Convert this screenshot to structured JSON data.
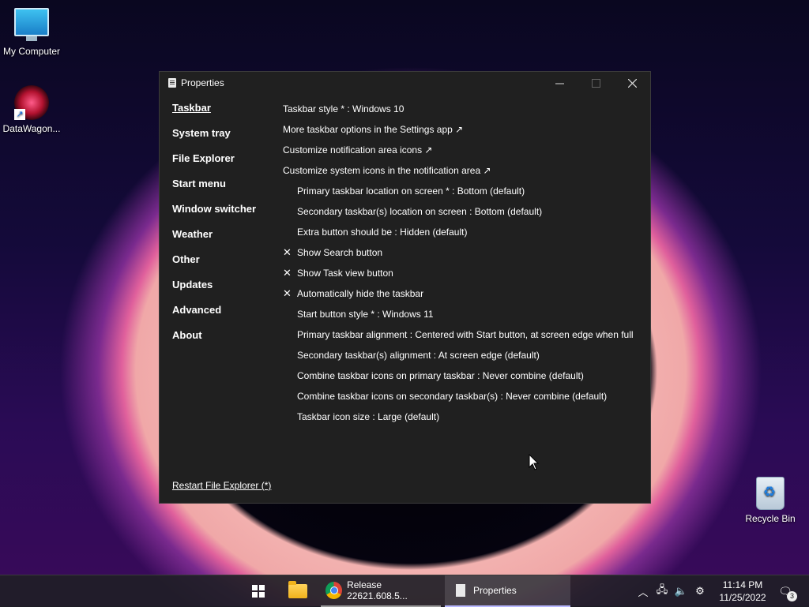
{
  "desktop": {
    "icons": [
      {
        "label": "My Computer"
      },
      {
        "label": "DataWagon..."
      },
      {
        "label": "Recycle Bin"
      }
    ]
  },
  "window": {
    "title": "Properties",
    "sidebar": [
      {
        "label": "Taskbar",
        "active": true
      },
      {
        "label": "System tray"
      },
      {
        "label": "File Explorer"
      },
      {
        "label": "Start menu"
      },
      {
        "label": "Window switcher"
      },
      {
        "label": "Weather"
      },
      {
        "label": "Other"
      },
      {
        "label": "Updates"
      },
      {
        "label": "Advanced"
      },
      {
        "label": "About"
      }
    ],
    "restart_link": "Restart File Explorer (*)",
    "settings": [
      {
        "text": "Taskbar style * : Windows 10"
      },
      {
        "text": "More taskbar options in the Settings app ↗"
      },
      {
        "text": "Customize notification area icons ↗"
      },
      {
        "text": "Customize system icons in the notification area ↗"
      },
      {
        "text": "Primary taskbar location on screen * : Bottom (default)"
      },
      {
        "text": "Secondary taskbar(s) location on screen : Bottom (default)"
      },
      {
        "text": "Extra button should be : Hidden (default)"
      },
      {
        "text": "Show Search button",
        "mark": "✕"
      },
      {
        "text": "Show Task view button",
        "mark": "✕"
      },
      {
        "text": "Automatically hide the taskbar",
        "mark": "✕"
      },
      {
        "text": "Start button style * : Windows 11"
      },
      {
        "text": "Primary taskbar alignment : Centered with Start button, at screen edge when full"
      },
      {
        "text": "Secondary taskbar(s) alignment : At screen edge (default)"
      },
      {
        "text": "Combine taskbar icons on primary taskbar : Never combine (default)"
      },
      {
        "text": "Combine taskbar icons on secondary taskbar(s) : Never combine (default)"
      },
      {
        "text": "Taskbar icon size : Large (default)"
      }
    ]
  },
  "taskbar": {
    "chrome_task_label": "Release 22621.608.5...",
    "properties_task_label": "Properties",
    "time": "11:14 PM",
    "date": "11/25/2022",
    "notification_count": "3"
  }
}
